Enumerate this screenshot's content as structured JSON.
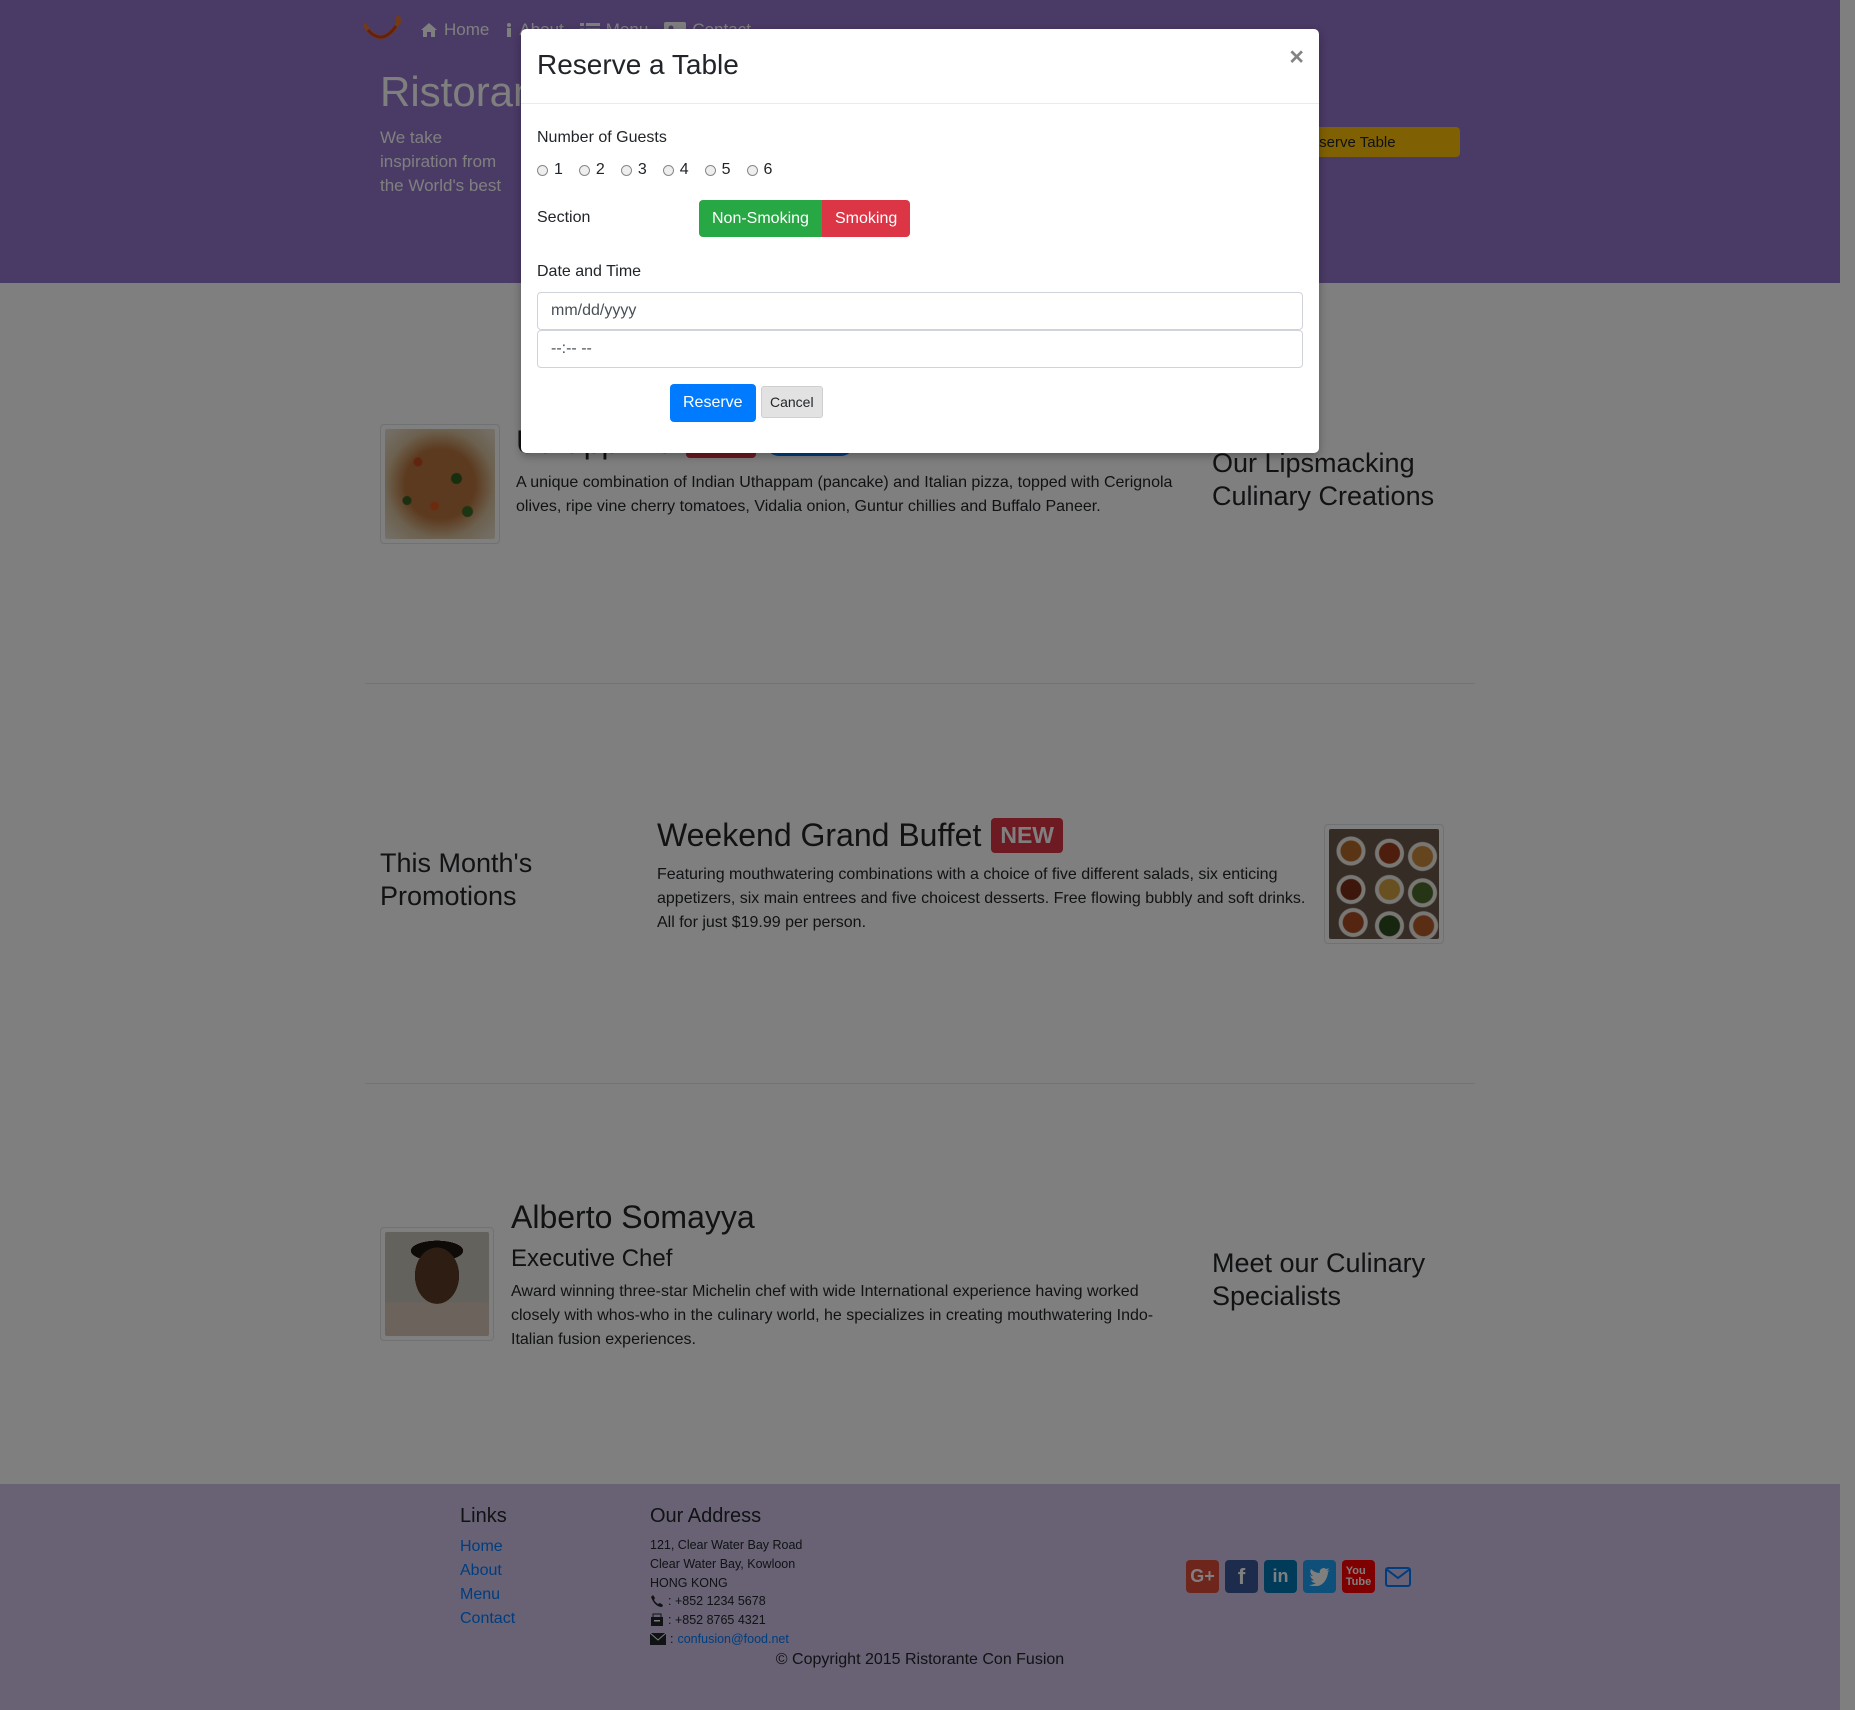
{
  "nav": {
    "items": [
      {
        "label": "Home",
        "icon": "home-icon"
      },
      {
        "label": "About",
        "icon": "info-icon"
      },
      {
        "label": "Menu",
        "icon": "list-icon"
      },
      {
        "label": "Contact",
        "icon": "address-card-icon"
      }
    ]
  },
  "jumbotron": {
    "title": "Ristorante Con Fusion",
    "text": "We take inspiration from the World's best cuisines, and create a unique fusion experience. Our lipsmacking creations will tickle your culinary senses!",
    "reserve_button": "Reserve Table"
  },
  "dish": {
    "title": "Uthappizza",
    "description": "A unique combination of Indian Uthappam (pancake) and Italian pizza, topped with Cerignola olives, ripe vine cherry tomatoes, Vidalia onion, Guntur chillies and Buffalo Paneer.",
    "heading": "Our Lipsmacking Culinary Creations"
  },
  "promotion": {
    "heading": "This Month's Promotions",
    "title": "Weekend Grand Buffet",
    "badge": "NEW",
    "description": "Featuring mouthwatering combinations with a choice of five different salads, six enticing appetizers, six main entrees and five choicest desserts. Free flowing bubbly and soft drinks. All for just $19.99 per person."
  },
  "leader": {
    "name": "Alberto Somayya",
    "role": "Executive Chef",
    "description": "Award winning three-star Michelin chef with wide International experience having worked closely with whos-who in the culinary world, he specializes in creating mouthwatering Indo-Italian fusion experiences.",
    "heading": "Meet our Culinary Specialists"
  },
  "footer": {
    "links_heading": "Links",
    "links": [
      "Home",
      "About",
      "Menu",
      "Contact"
    ],
    "address_heading": "Our Address",
    "address_lines": [
      "121, Clear Water Bay Road",
      "Clear Water Bay, Kowloon",
      "HONG KONG"
    ],
    "phone": ": +852 1234 5678",
    "fax": ": +852 8765 4321",
    "email": "confusion@food.net",
    "social_icons": [
      "google-plus-icon",
      "facebook-icon",
      "linkedin-icon",
      "twitter-icon",
      "youtube-icon",
      "envelope-icon"
    ],
    "copyright": "© Copyright 2015 Ristorante Con Fusion"
  },
  "modal": {
    "title": "Reserve a Table",
    "close": "×",
    "guests_label": "Number of Guests",
    "guest_options": [
      "1",
      "2",
      "3",
      "4",
      "5",
      "6"
    ],
    "section_label": "Section",
    "non_smoking": "Non-Smoking",
    "smoking": "Smoking",
    "datetime_label": "Date and Time",
    "date_placeholder": "mm/dd/yyyy",
    "time_placeholder": "--:-- --",
    "reserve_button": "Reserve",
    "cancel_button": "Cancel"
  },
  "colors": {
    "header_bg": "#9575cd",
    "footer_bg": "#d1c4e9",
    "accent_warning": "#ffc107",
    "success": "#28a745",
    "danger": "#dc3545",
    "primary": "#007bff"
  }
}
